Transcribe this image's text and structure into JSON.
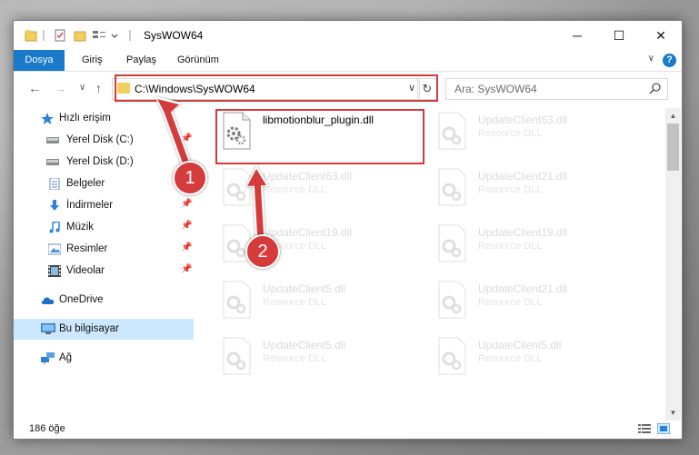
{
  "window": {
    "title": "SysWOW64",
    "minimize_label": "─",
    "maximize_label": "☐",
    "close_label": "✕"
  },
  "ribbon": {
    "tabs": [
      "Dosya",
      "Giriş",
      "Paylaş",
      "Görünüm"
    ],
    "help_label": "?",
    "collapse_label": "∨"
  },
  "nav": {
    "back_label": "←",
    "forward_label": "→",
    "history_label": "∨",
    "up_label": "↑",
    "address": "C:\\Windows\\SysWOW64",
    "address_dropdown": "∨",
    "refresh_label": "↻",
    "search_placeholder": "Ara: SysWOW64"
  },
  "sidebar": {
    "items": [
      {
        "label": "Hızlı erişim",
        "icon": "star-icon",
        "pinned": false
      },
      {
        "label": "Yerel Disk (C:)",
        "icon": "drive-icon",
        "pinned": true
      },
      {
        "label": "Yerel Disk (D:)",
        "icon": "drive-icon",
        "pinned": false
      },
      {
        "label": "Belgeler",
        "icon": "document-icon",
        "pinned": true
      },
      {
        "label": "İndirmeler",
        "icon": "download-icon",
        "pinned": true
      },
      {
        "label": "Müzik",
        "icon": "music-icon",
        "pinned": true
      },
      {
        "label": "Resimler",
        "icon": "pictures-icon",
        "pinned": true
      },
      {
        "label": "Videolar",
        "icon": "video-icon",
        "pinned": true
      },
      {
        "label": "OneDrive",
        "icon": "cloud-icon",
        "pinned": false
      },
      {
        "label": "Bu bilgisayar",
        "icon": "computer-icon",
        "pinned": false,
        "selected": true
      },
      {
        "label": "Ağ",
        "icon": "network-icon",
        "pinned": false
      }
    ],
    "pin_glyph": "📌"
  },
  "files": {
    "highlighted": {
      "name": "libmotionblur_plugin.dll"
    },
    "column1": [
      {
        "name": "UpdateClient63.dll",
        "type": "Resource DLL"
      },
      {
        "name": "UpdateClient19.dll",
        "type": "Resource DLL"
      },
      {
        "name": "UpdateClient5.dll",
        "type": "Resource DLL"
      },
      {
        "name": "UpdateClient5.dll",
        "type": "Resource DLL"
      }
    ],
    "column2": [
      {
        "name": "UpdateClient63.dll",
        "type": "Resource DLL"
      },
      {
        "name": "UpdateClient21.dll",
        "type": "Resource DLL"
      },
      {
        "name": "UpdateClient19.dll",
        "type": "Resource DLL"
      },
      {
        "name": "UpdateClient21.dll",
        "type": "Resource DLL"
      },
      {
        "name": "UpdateClient5.dll",
        "type": "Resource DLL"
      }
    ]
  },
  "status": {
    "item_count": "186 öğe"
  },
  "annotations": {
    "step1": "1",
    "step2": "2",
    "color": "#d63b3b"
  },
  "colors": {
    "accent": "#1979ca",
    "selection": "#cce8ff",
    "highlight_box": "#d33a3a"
  }
}
